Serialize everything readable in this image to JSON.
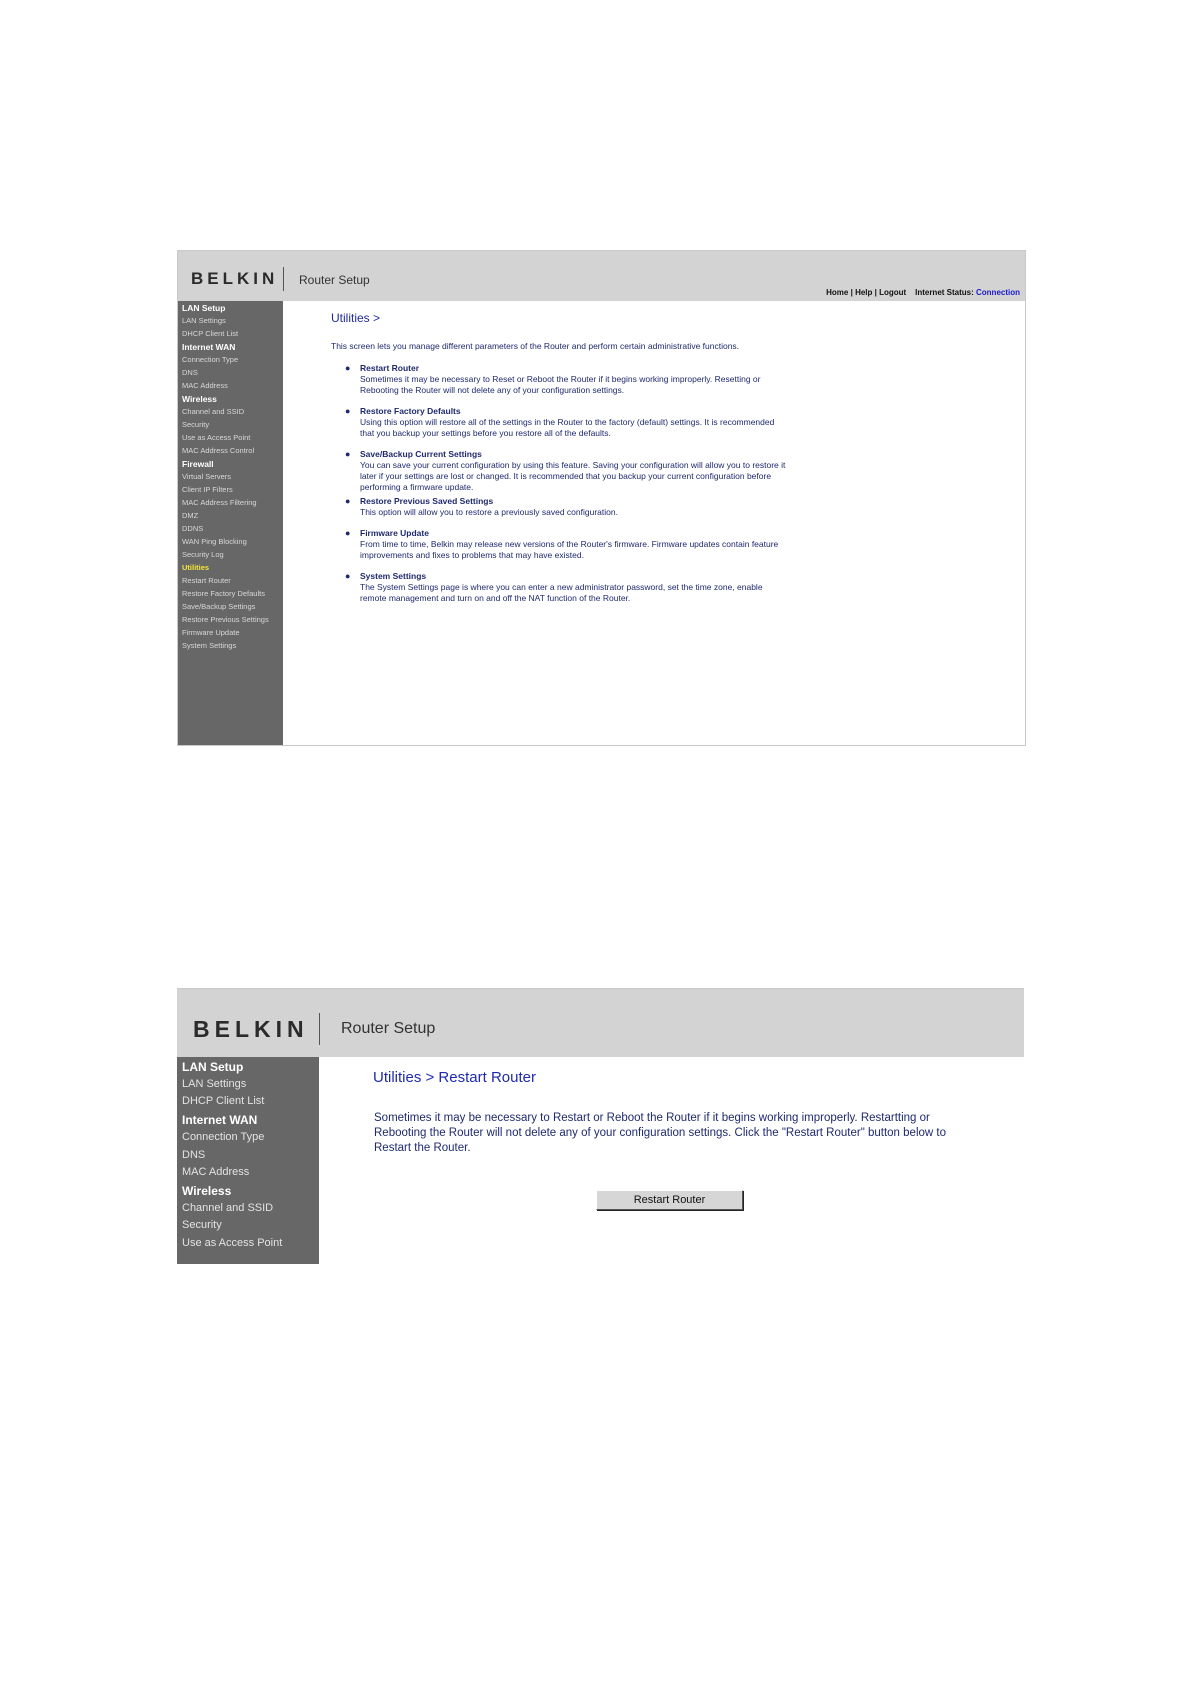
{
  "shot1": {
    "brand": "BELKIN",
    "product": "Router Setup",
    "toplinks": {
      "home": "Home",
      "sep1": " | ",
      "help": "Help",
      "sep2": " | ",
      "logout": "Logout",
      "status_label": "Internet Status:",
      "status_value": "Connection"
    },
    "sidebar": [
      {
        "label": "LAN Setup",
        "type": "head"
      },
      {
        "label": "LAN Settings",
        "type": "item"
      },
      {
        "label": "DHCP Client List",
        "type": "item"
      },
      {
        "label": "Internet WAN",
        "type": "head"
      },
      {
        "label": "Connection Type",
        "type": "item"
      },
      {
        "label": "DNS",
        "type": "item"
      },
      {
        "label": "MAC Address",
        "type": "item"
      },
      {
        "label": "Wireless",
        "type": "head"
      },
      {
        "label": "Channel and SSID",
        "type": "item"
      },
      {
        "label": "Security",
        "type": "item"
      },
      {
        "label": "Use as Access Point",
        "type": "item"
      },
      {
        "label": "MAC Address Control",
        "type": "item"
      },
      {
        "label": "Firewall",
        "type": "head"
      },
      {
        "label": "Virtual Servers",
        "type": "item"
      },
      {
        "label": "Client IP Filters",
        "type": "item"
      },
      {
        "label": "MAC Address Filtering",
        "type": "item"
      },
      {
        "label": "DMZ",
        "type": "item"
      },
      {
        "label": "DDNS",
        "type": "item"
      },
      {
        "label": "WAN Ping Blocking",
        "type": "item"
      },
      {
        "label": "Security Log",
        "type": "item"
      },
      {
        "label": "Utilities",
        "type": "active"
      },
      {
        "label": "Restart Router",
        "type": "item"
      },
      {
        "label": "Restore Factory Defaults",
        "type": "item"
      },
      {
        "label": "Save/Backup Settings",
        "type": "item"
      },
      {
        "label": "Restore Previous Settings",
        "type": "item"
      },
      {
        "label": "Firmware Update",
        "type": "item"
      },
      {
        "label": "System Settings",
        "type": "item"
      }
    ],
    "page_title": "Utilities >",
    "intro": "This screen lets you manage different parameters of the Router and perform certain administrative functions.",
    "entries": [
      {
        "title": "Restart Router",
        "text": "Sometimes it may be necessary to Reset or Reboot the Router if it begins working improperly. Resetting or Rebooting the Router will not delete any of your configuration settings."
      },
      {
        "title": "Restore Factory Defaults",
        "text": "Using this option will restore all of the settings in the Router to the factory (default) settings. It is recommended that you backup your settings before you restore all of the defaults."
      },
      {
        "title": "Save/Backup Current Settings",
        "text": "You can save your current configuration by using this feature. Saving your configuration will allow you to restore it later if your settings are lost or changed. It is recommended that you backup your current configuration before performing a firmware update."
      },
      {
        "title": "Restore Previous Saved Settings",
        "text": "This option will allow you to restore a previously saved configuration."
      },
      {
        "title": "Firmware Update",
        "text": "From time to time, Belkin may release new versions of the Router's firmware. Firmware updates contain feature improvements and fixes to problems that may have existed."
      },
      {
        "title": "System Settings",
        "text": "The System Settings page is where you can enter a new administrator password, set the time zone, enable remote management and turn on and off the NAT function of the Router."
      }
    ]
  },
  "shot2": {
    "brand": "BELKIN",
    "product": "Router Setup",
    "sidebar": [
      {
        "label": "LAN Setup",
        "type": "head"
      },
      {
        "label": "LAN Settings",
        "type": "item"
      },
      {
        "label": "DHCP Client List",
        "type": "item"
      },
      {
        "label": "Internet WAN",
        "type": "head"
      },
      {
        "label": "Connection Type",
        "type": "item"
      },
      {
        "label": "DNS",
        "type": "item"
      },
      {
        "label": "MAC Address",
        "type": "item"
      },
      {
        "label": "Wireless",
        "type": "head"
      },
      {
        "label": "Channel and SSID",
        "type": "item"
      },
      {
        "label": "Security",
        "type": "item"
      },
      {
        "label": "Use as Access Point",
        "type": "item"
      }
    ],
    "page_title": "Utilities > Restart Router",
    "description": "Sometimes it may be necessary to Restart or Reboot the Router if it begins working improperly. Restartting or Rebooting the Router will not delete any of your configuration settings. Click the \"Restart Router\" button below to Restart the Router.",
    "restart_button": "Restart Router"
  },
  "colors": {
    "header_bg": "#d3d3d3",
    "sidebar_bg": "#676767",
    "active_item": "#f2e63a",
    "title_blue": "#1f2a9e",
    "link_blue": "#1a1ad0"
  }
}
